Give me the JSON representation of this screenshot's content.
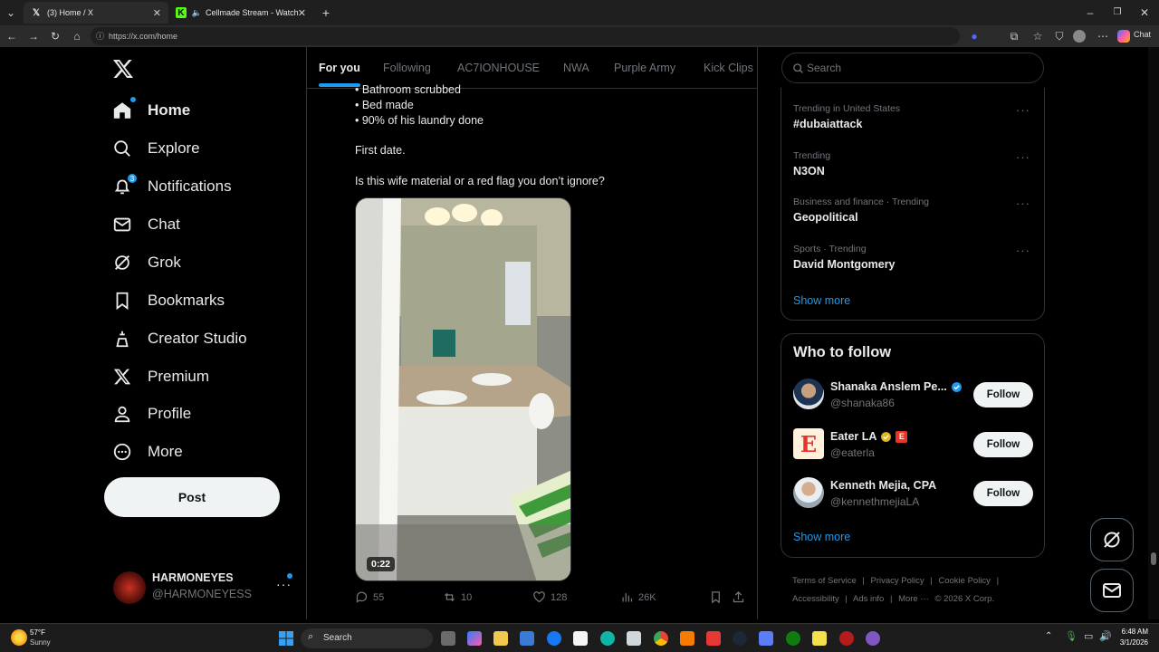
{
  "browser": {
    "tabs": [
      {
        "title": "(3) Home / X",
        "active": true
      },
      {
        "title": "Cellmade Stream - Watch Li",
        "active": false
      }
    ],
    "url": "https://x.com/home",
    "chat_label": "Chat"
  },
  "sidebar": {
    "items": [
      {
        "label": "Home",
        "icon": "home-icon"
      },
      {
        "label": "Explore",
        "icon": "search-icon"
      },
      {
        "label": "Notifications",
        "icon": "bell-icon",
        "badge": "3"
      },
      {
        "label": "Chat",
        "icon": "mail-icon"
      },
      {
        "label": "Grok",
        "icon": "grok-icon"
      },
      {
        "label": "Bookmarks",
        "icon": "bookmark-icon"
      },
      {
        "label": "Creator Studio",
        "icon": "creator-icon"
      },
      {
        "label": "Premium",
        "icon": "x-icon"
      },
      {
        "label": "Profile",
        "icon": "profile-icon"
      },
      {
        "label": "More",
        "icon": "more-circle-icon"
      }
    ],
    "post_label": "Post",
    "account": {
      "name": "HARMONEYES",
      "handle": "@HARMONEYESS"
    }
  },
  "feed": {
    "tabs": [
      "For you",
      "Following",
      "AC7IONHOUSE",
      "NWA",
      "Purple Army",
      "Kick Clips"
    ],
    "post": {
      "lines": [
        "• Bathroom scrubbed",
        "• Bed made",
        "• 90% of his laundry done"
      ],
      "line2": "First date.",
      "line3": "Is this wife material or a red flag you don’t ignore?",
      "duration": "0:22",
      "replies": "55",
      "reposts": "10",
      "likes": "128",
      "views": "26K"
    }
  },
  "right": {
    "search_placeholder": "Search",
    "trends": [
      {
        "context": "Trending in United States",
        "name": "#dubaiattack"
      },
      {
        "context": "Trending",
        "name": "N3ON"
      },
      {
        "context": "Business and finance · Trending",
        "name": "Geopolitical"
      },
      {
        "context": "Sports · Trending",
        "name": "David Montgomery"
      }
    ],
    "show_more": "Show more",
    "who_to_follow": {
      "title": "Who to follow",
      "accounts": [
        {
          "name": "Shanaka Anslem Pe...",
          "handle": "@shanaka86"
        },
        {
          "name": "Eater LA",
          "handle": "@eaterla"
        },
        {
          "name": "Kenneth Mejia, CPA",
          "handle": "@kennethmejiaLA"
        }
      ],
      "follow_label": "Follow",
      "show_more": "Show more"
    },
    "footer": [
      "Terms of Service",
      "|",
      "Privacy Policy",
      "|",
      "Cookie Policy",
      "|",
      "Accessibility",
      "|",
      "Ads info",
      "|",
      "More ···",
      "© 2026 X Corp."
    ]
  },
  "taskbar": {
    "weather_temp": "57°F",
    "weather_cond": "Sunny",
    "search_label": "Search",
    "time": "6:48 AM",
    "date": "3/1/2026"
  },
  "colors": {
    "accent": "#1d9bf0",
    "background": "#000000",
    "text": "#e7e9ea",
    "muted": "#71767b",
    "border": "#2f3336"
  }
}
